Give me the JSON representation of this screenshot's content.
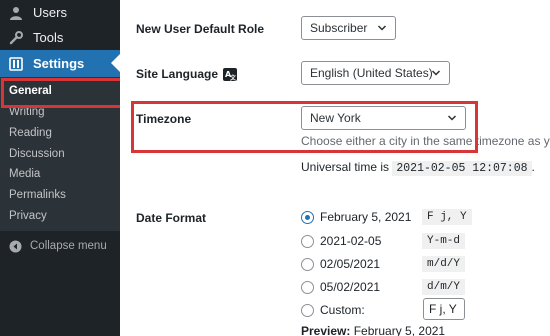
{
  "sidebar": {
    "items": [
      {
        "label": "Users",
        "icon": "users-icon"
      },
      {
        "label": "Tools",
        "icon": "wrench-icon"
      },
      {
        "label": "Settings",
        "icon": "settings-icon"
      }
    ],
    "submenu": [
      "General",
      "Writing",
      "Reading",
      "Discussion",
      "Media",
      "Permalinks",
      "Privacy"
    ],
    "collapse_label": "Collapse menu"
  },
  "main": {
    "default_role": {
      "label": "New User Default Role",
      "value": "Subscriber"
    },
    "site_language": {
      "label": "Site Language",
      "value": "English (United States)"
    },
    "timezone": {
      "label": "Timezone",
      "value": "New York",
      "description": "Choose either a city in the same timezone as you or",
      "universal_label": "Universal time is",
      "universal_value": "2021-02-05 12:07:08",
      "universal_suffix": "."
    },
    "date_format": {
      "label": "Date Format",
      "options": [
        {
          "label": "February 5, 2021",
          "code": "F j, Y",
          "checked": true
        },
        {
          "label": "2021-02-05",
          "code": "Y-m-d",
          "checked": false
        },
        {
          "label": "02/05/2021",
          "code": "m/d/Y",
          "checked": false
        },
        {
          "label": "05/02/2021",
          "code": "d/m/Y",
          "checked": false
        }
      ],
      "custom_label": "Custom:",
      "custom_value": "F j, Y",
      "preview_label": "Preview:",
      "preview_value": "February 5, 2021"
    }
  },
  "colors": {
    "accent": "#2271b1",
    "highlight": "#d63638",
    "sidebar": "#1d2327"
  }
}
